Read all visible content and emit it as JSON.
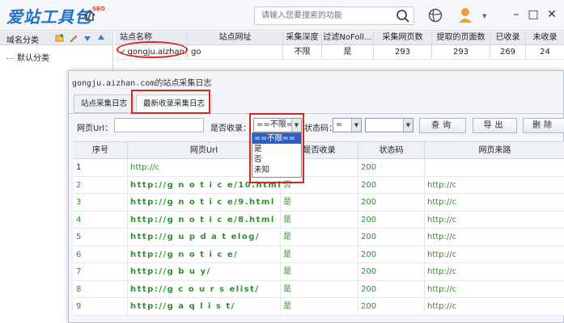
{
  "app": {
    "logo_main": "爱站工具包",
    "logo_badge": "SEO",
    "search_placeholder": "请输入您要搜索的功能"
  },
  "left_panel": {
    "header": "域名分类",
    "tree_item": "默认分类"
  },
  "site_table": {
    "headers": [
      "站点名称",
      "站点网址",
      "采集深度",
      "过滤NoFoll...",
      "采集网页数",
      "提取的页面数",
      "已收录",
      "未收录"
    ],
    "row": [
      "gongju.aizhan...",
      "go",
      "不限",
      "是",
      "293",
      "293",
      "269",
      "24"
    ]
  },
  "dialog": {
    "title": "gongju.aizhan.com的站点采集日志",
    "tabs": [
      "站点采集日志",
      "最新收录采集日志"
    ],
    "filter": {
      "url_label": "网页Url：",
      "indexed_label": "是否收录：",
      "indexed_value": "==不限==",
      "status_label": "状态码：",
      "status_op": "=",
      "btn_query": "查询",
      "btn_export": "导出",
      "btn_delete": "删除"
    },
    "dropdown_options": [
      "==不限==",
      "是",
      "否",
      "未知"
    ],
    "grid": {
      "headers": [
        "序号",
        "网页Url",
        "是否收录",
        "状态码",
        "网页来路"
      ],
      "rows": [
        {
          "id": "1",
          "url": "http://c",
          "idx": "",
          "code": "200",
          "ref": ""
        },
        {
          "id": "2",
          "url": "http://g n o t i c e/10.html",
          "idx": "否",
          "code": "200",
          "ref": "http://c"
        },
        {
          "id": "3",
          "url": "http://g n o t i c e/9.html",
          "idx": "是",
          "code": "200",
          "ref": "http://c"
        },
        {
          "id": "4",
          "url": "http://g n o t i c e/8.html",
          "idx": "是",
          "code": "200",
          "ref": "http://c"
        },
        {
          "id": "5",
          "url": "http://g u p d a t elog/",
          "idx": "是",
          "code": "200",
          "ref": "http://c"
        },
        {
          "id": "6",
          "url": "http://g n o t i c e/",
          "idx": "是",
          "code": "200",
          "ref": "http://c"
        },
        {
          "id": "7",
          "url": "http://g b u y/",
          "idx": "是",
          "code": "200",
          "ref": "http://c"
        },
        {
          "id": "8",
          "url": "http://g c o u r s elist/",
          "idx": "是",
          "code": "200",
          "ref": "http://c"
        },
        {
          "id": "9",
          "url": "http://g a q l i s t/",
          "idx": "是",
          "code": "200",
          "ref": "http://c"
        }
      ]
    }
  }
}
